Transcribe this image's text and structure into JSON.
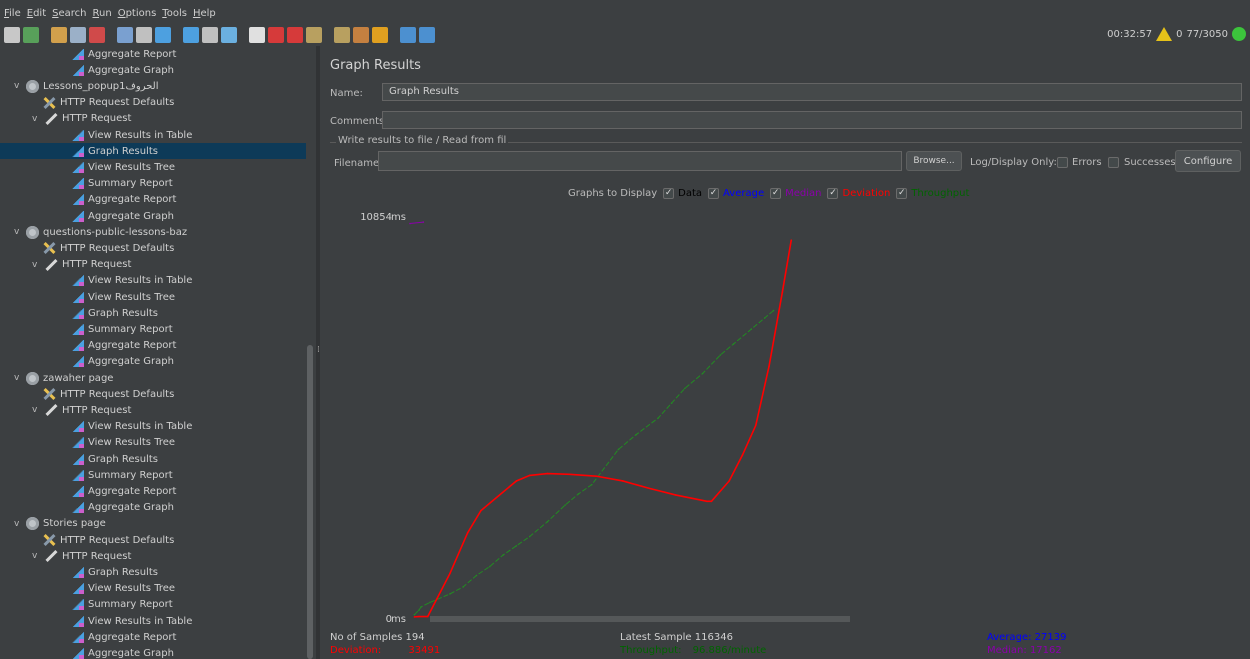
{
  "menu": [
    {
      "u": "F",
      "rest": "ile"
    },
    {
      "u": "E",
      "rest": "dit"
    },
    {
      "u": "S",
      "rest": "earch"
    },
    {
      "u": "R",
      "rest": "un"
    },
    {
      "u": "O",
      "rest": "ptions"
    },
    {
      "u": "T",
      "rest": "ools"
    },
    {
      "u": "H",
      "rest": "elp"
    }
  ],
  "toolbar_colors": [
    "#c8c8c8",
    "#58a05a",
    "#d2a04c",
    "#9bb0c8",
    "#d04a4a",
    "#7aa0d0",
    "#c0c0c0",
    "#4da0e0",
    "#4da0e0",
    "#c0c0c0",
    "#6bb0e0",
    "#e0e0e0",
    "#d63a3a",
    "#d63a3a",
    "#b8a060",
    "#b8a060",
    "#c48040",
    "#e0a020",
    "#4c90d0",
    "#4c90d0"
  ],
  "status": {
    "time": "00:32:57",
    "warnings": "0",
    "threads": "77/3050"
  },
  "tree": [
    {
      "label": "Aggregate Report",
      "icon": "grapher",
      "indent": 3,
      "chev": ""
    },
    {
      "label": "Aggregate Graph",
      "icon": "grapher",
      "indent": 3,
      "chev": ""
    },
    {
      "label": "Lessons_popup1الحروف",
      "icon": "gear",
      "indent": 1,
      "chev": "∨"
    },
    {
      "label": "HTTP Request Defaults",
      "icon": "wrench",
      "indent": 2,
      "chev": ""
    },
    {
      "label": "HTTP Request",
      "icon": "pen",
      "indent": 2,
      "chev": "∨"
    },
    {
      "label": "View Results in Table",
      "icon": "grapher",
      "indent": 3,
      "chev": ""
    },
    {
      "label": "Graph Results",
      "icon": "grapher",
      "indent": 3,
      "chev": "",
      "selected": true
    },
    {
      "label": "View Results Tree",
      "icon": "grapher",
      "indent": 3,
      "chev": ""
    },
    {
      "label": "Summary Report",
      "icon": "grapher",
      "indent": 3,
      "chev": ""
    },
    {
      "label": "Aggregate Report",
      "icon": "grapher",
      "indent": 3,
      "chev": ""
    },
    {
      "label": "Aggregate Graph",
      "icon": "grapher",
      "indent": 3,
      "chev": ""
    },
    {
      "label": "questions-public-lessons-baz",
      "icon": "gear",
      "indent": 1,
      "chev": "∨"
    },
    {
      "label": "HTTP Request Defaults",
      "icon": "wrench",
      "indent": 2,
      "chev": ""
    },
    {
      "label": "HTTP Request",
      "icon": "pen",
      "indent": 2,
      "chev": "∨"
    },
    {
      "label": "View Results in Table",
      "icon": "grapher",
      "indent": 3,
      "chev": ""
    },
    {
      "label": "View Results Tree",
      "icon": "grapher",
      "indent": 3,
      "chev": ""
    },
    {
      "label": "Graph Results",
      "icon": "grapher",
      "indent": 3,
      "chev": ""
    },
    {
      "label": "Summary Report",
      "icon": "grapher",
      "indent": 3,
      "chev": ""
    },
    {
      "label": "Aggregate Report",
      "icon": "grapher",
      "indent": 3,
      "chev": ""
    },
    {
      "label": "Aggregate Graph",
      "icon": "grapher",
      "indent": 3,
      "chev": ""
    },
    {
      "label": "zawaher page",
      "icon": "gear",
      "indent": 1,
      "chev": "∨"
    },
    {
      "label": "HTTP Request Defaults",
      "icon": "wrench",
      "indent": 2,
      "chev": ""
    },
    {
      "label": "HTTP Request",
      "icon": "pen",
      "indent": 2,
      "chev": "∨"
    },
    {
      "label": "View Results in Table",
      "icon": "grapher",
      "indent": 3,
      "chev": ""
    },
    {
      "label": "View Results Tree",
      "icon": "grapher",
      "indent": 3,
      "chev": ""
    },
    {
      "label": "Graph Results",
      "icon": "grapher",
      "indent": 3,
      "chev": ""
    },
    {
      "label": "Summary Report",
      "icon": "grapher",
      "indent": 3,
      "chev": ""
    },
    {
      "label": "Aggregate Report",
      "icon": "grapher",
      "indent": 3,
      "chev": ""
    },
    {
      "label": "Aggregate Graph",
      "icon": "grapher",
      "indent": 3,
      "chev": ""
    },
    {
      "label": "Stories page",
      "icon": "gear",
      "indent": 1,
      "chev": "∨"
    },
    {
      "label": "HTTP Request Defaults",
      "icon": "wrench",
      "indent": 2,
      "chev": ""
    },
    {
      "label": "HTTP Request",
      "icon": "pen",
      "indent": 2,
      "chev": "∨"
    },
    {
      "label": "Graph Results",
      "icon": "grapher",
      "indent": 3,
      "chev": ""
    },
    {
      "label": "View Results Tree",
      "icon": "grapher",
      "indent": 3,
      "chev": ""
    },
    {
      "label": "Summary Report",
      "icon": "grapher",
      "indent": 3,
      "chev": ""
    },
    {
      "label": "View Results in Table",
      "icon": "grapher",
      "indent": 3,
      "chev": ""
    },
    {
      "label": "Aggregate Report",
      "icon": "grapher",
      "indent": 3,
      "chev": ""
    },
    {
      "label": "Aggregate Graph",
      "icon": "grapher",
      "indent": 3,
      "chev": ""
    }
  ],
  "panel": {
    "title": "Graph Results",
    "name_label": "Name:",
    "name_value": "Graph Results",
    "comments_label": "Comments",
    "comments_value": "",
    "group_title": "Write results to file / Read from fil",
    "filename_label": "Filename",
    "filename_value": "",
    "browse": "Browse...",
    "log_only": "Log/Display Only:",
    "errors": "Errors",
    "successes": "Successes",
    "configure": "Configure",
    "graphs_to_display": "Graphs to Display",
    "opt_data": "Data",
    "opt_average": "Average",
    "opt_median": "Median",
    "opt_deviation": "Deviation",
    "opt_throughput": "Throughput",
    "colors": {
      "data": "#000000",
      "average": "#0000ff",
      "median": "#8b00ab",
      "deviation": "#ff0000",
      "throughput": "#006400"
    }
  },
  "chart_data": {
    "type": "line",
    "y_top_label": "10854",
    "y_bottom_label": "0",
    "y_unit": "ms",
    "ylim": [
      0,
      10854
    ],
    "x_samples": 194,
    "series": [
      {
        "name": "Throughput",
        "color": "#228b22",
        "points": [
          [
            2,
            90
          ],
          [
            4,
            210
          ],
          [
            5,
            300
          ],
          [
            9,
            420
          ],
          [
            18,
            650
          ],
          [
            24,
            840
          ],
          [
            30,
            1150
          ],
          [
            36,
            1390
          ],
          [
            42,
            1700
          ],
          [
            48,
            1950
          ],
          [
            54,
            2200
          ],
          [
            62,
            2600
          ],
          [
            70,
            3050
          ],
          [
            76,
            3350
          ],
          [
            82,
            3600
          ],
          [
            94,
            4550
          ],
          [
            102,
            4950
          ],
          [
            112,
            5400
          ],
          [
            118,
            5800
          ],
          [
            124,
            6200
          ],
          [
            132,
            6600
          ],
          [
            140,
            7100
          ],
          [
            146,
            7400
          ],
          [
            154,
            7800
          ],
          [
            160,
            8100
          ],
          [
            164,
            8300
          ]
        ]
      },
      {
        "name": "Deviation",
        "color": "#ff0000",
        "points": [
          [
            2,
            30
          ],
          [
            4,
            40
          ],
          [
            8,
            40
          ],
          [
            18,
            1200
          ],
          [
            26,
            2300
          ],
          [
            32,
            2900
          ],
          [
            40,
            3300
          ],
          [
            48,
            3700
          ],
          [
            54,
            3850
          ],
          [
            62,
            3900
          ],
          [
            72,
            3880
          ],
          [
            84,
            3830
          ],
          [
            96,
            3700
          ],
          [
            108,
            3500
          ],
          [
            120,
            3320
          ],
          [
            134,
            3150
          ],
          [
            136,
            3150
          ],
          [
            144,
            3700
          ],
          [
            150,
            4400
          ],
          [
            156,
            5200
          ],
          [
            162,
            6800
          ],
          [
            168,
            8800
          ],
          [
            172,
            10200
          ]
        ]
      },
      {
        "name": "Median",
        "color": "#8b00ab",
        "points": [
          [
            0,
            10650
          ],
          [
            6,
            10690
          ]
        ]
      }
    ]
  },
  "stats": {
    "samples_label": "No of Samples",
    "samples_value": "194",
    "latest_label": "Latest Sample",
    "latest_value": "116346",
    "average_label": "Average:",
    "average_value": "27139",
    "deviation_label": "Deviation:",
    "deviation_value": "33491",
    "throughput_label": "Throughput:",
    "throughput_value": "96.886/minute",
    "median_label": "Median:",
    "median_value": "17162"
  }
}
